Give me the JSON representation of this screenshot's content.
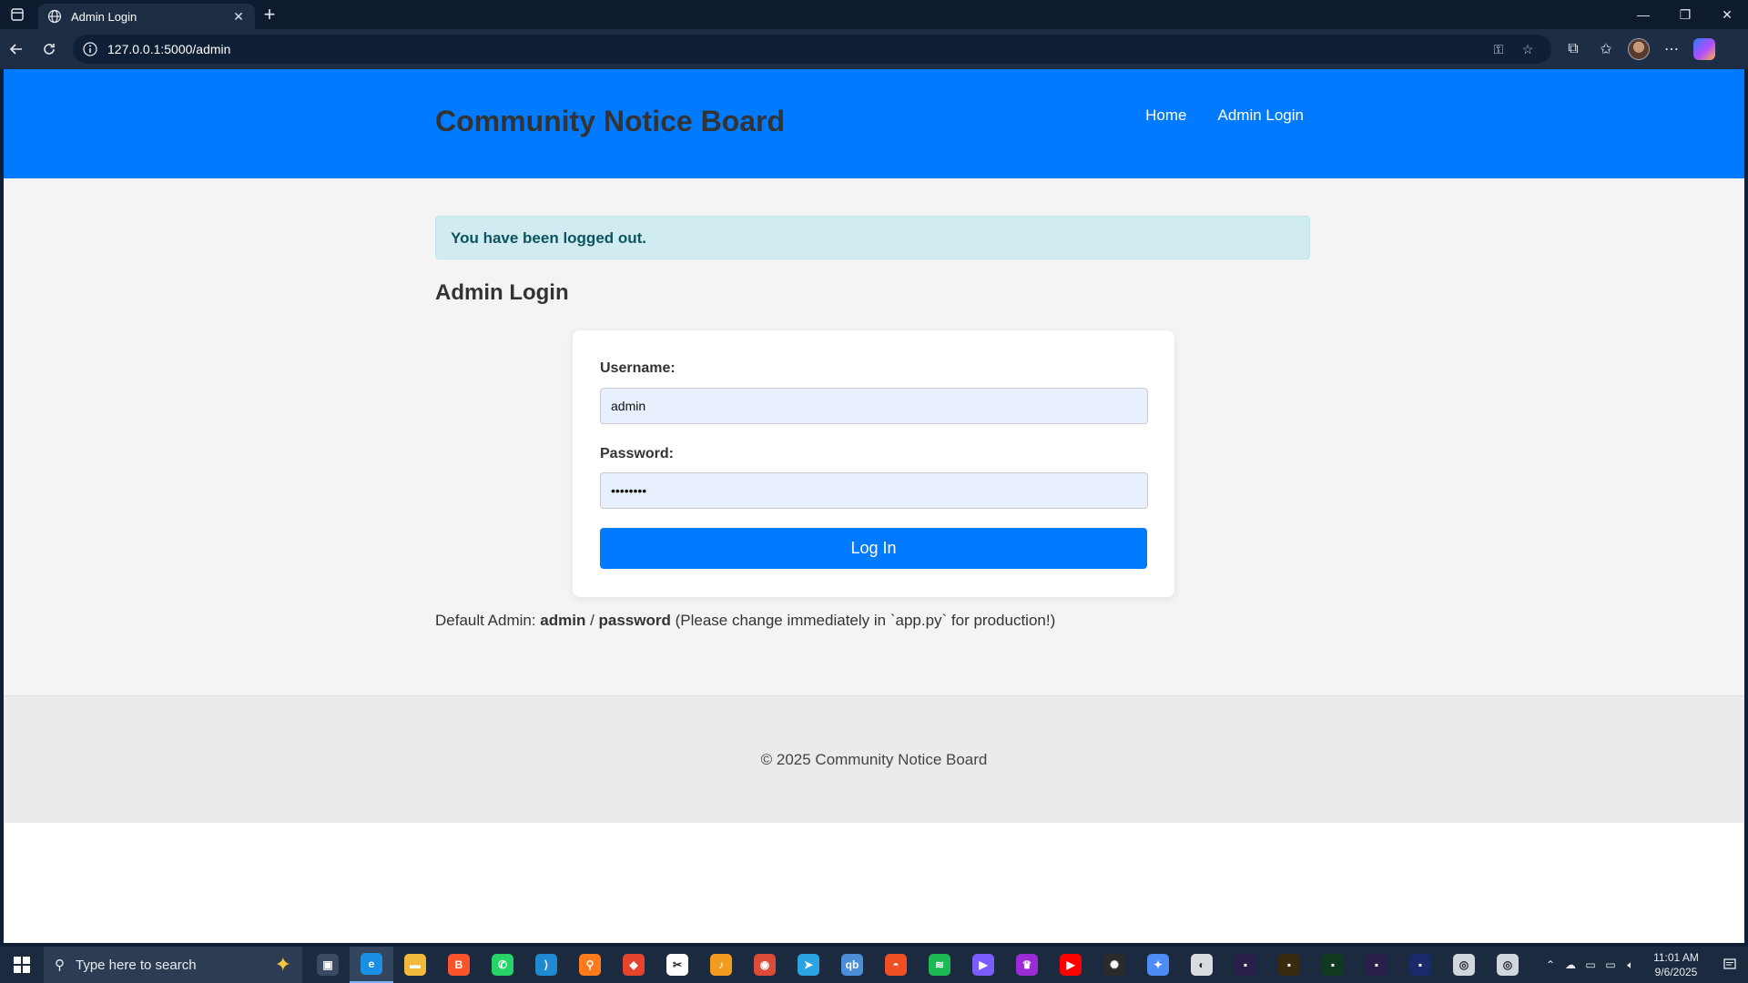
{
  "browser": {
    "tab_title": "Admin Login",
    "url": "127.0.0.1:5000/admin",
    "new_tab_label": "+"
  },
  "site": {
    "title": "Community Notice Board",
    "nav": [
      {
        "label": "Home"
      },
      {
        "label": "Admin Login"
      }
    ],
    "flash_message": "You have been logged out.",
    "page_heading": "Admin Login",
    "form": {
      "username_label": "Username:",
      "username_value": "admin",
      "password_label": "Password:",
      "password_value": "password",
      "submit_label": "Log In"
    },
    "default_note": {
      "prefix": "Default Admin: ",
      "user": "admin",
      "separator": " / ",
      "password": "password",
      "suffix": " (Please change immediately in `app.py` for production!)"
    },
    "footer": "© 2025 Community Notice Board"
  },
  "taskbar": {
    "search_placeholder": "Type here to search",
    "time": "11:01 AM",
    "date": "9/6/2025",
    "apps": [
      {
        "name": "task-view",
        "color": "#3a4a61",
        "glyph": "▣"
      },
      {
        "name": "edge",
        "color": "#1a8fe3",
        "glyph": "e"
      },
      {
        "name": "file-explorer",
        "color": "#f2b83a",
        "glyph": "▬"
      },
      {
        "name": "brave",
        "color": "#fb542b",
        "glyph": "B"
      },
      {
        "name": "whatsapp",
        "color": "#25d366",
        "glyph": "✆"
      },
      {
        "name": "vscode",
        "color": "#1f8ad2",
        "glyph": "⟩"
      },
      {
        "name": "search-app",
        "color": "#ff7a1a",
        "glyph": "⚲"
      },
      {
        "name": "anydesk",
        "color": "#e8432d",
        "glyph": "◆"
      },
      {
        "name": "capcut",
        "color": "#ffffff",
        "glyph": "✂"
      },
      {
        "name": "fl-studio",
        "color": "#f29b1f",
        "glyph": "♪"
      },
      {
        "name": "chrome",
        "color": "#dd4b39",
        "glyph": "◉"
      },
      {
        "name": "telegram",
        "color": "#2aa3e2",
        "glyph": "➤"
      },
      {
        "name": "qbittorrent",
        "color": "#4a8fd8",
        "glyph": "qb"
      },
      {
        "name": "app-orange",
        "color": "#f04e23",
        "glyph": "◓"
      },
      {
        "name": "spotify",
        "color": "#1db954",
        "glyph": "≋"
      },
      {
        "name": "app-purple",
        "color": "#7b5cff",
        "glyph": "▶"
      },
      {
        "name": "app-violet",
        "color": "#9b2bd6",
        "glyph": "♛"
      },
      {
        "name": "youtube",
        "color": "#ff0000",
        "glyph": "▶"
      },
      {
        "name": "chatgpt",
        "color": "#2b2b2b",
        "glyph": "✺"
      },
      {
        "name": "gemini",
        "color": "#4d8bf5",
        "glyph": "✦"
      },
      {
        "name": "app-gamepad",
        "color": "#d8dbe0",
        "glyph": "◐"
      },
      {
        "name": "app-dark1",
        "color": "#2a1f4a",
        "glyph": "▪"
      },
      {
        "name": "app-dark2",
        "color": "#3a2a10",
        "glyph": "▪"
      },
      {
        "name": "app-dark3",
        "color": "#0f3a1f",
        "glyph": "▪"
      },
      {
        "name": "app-dark4",
        "color": "#2a1f4a",
        "glyph": "▪"
      },
      {
        "name": "app-dark5",
        "color": "#1a2a6a",
        "glyph": "▪"
      },
      {
        "name": "app-light1",
        "color": "#d0d6de",
        "glyph": "◎"
      },
      {
        "name": "app-light2",
        "color": "#d0d6de",
        "glyph": "◎"
      }
    ]
  },
  "colors": {
    "primary": "#007bff",
    "flash_bg": "#d1ecf1",
    "flash_text": "#0c5460",
    "input_bg": "#e8f0fe"
  }
}
